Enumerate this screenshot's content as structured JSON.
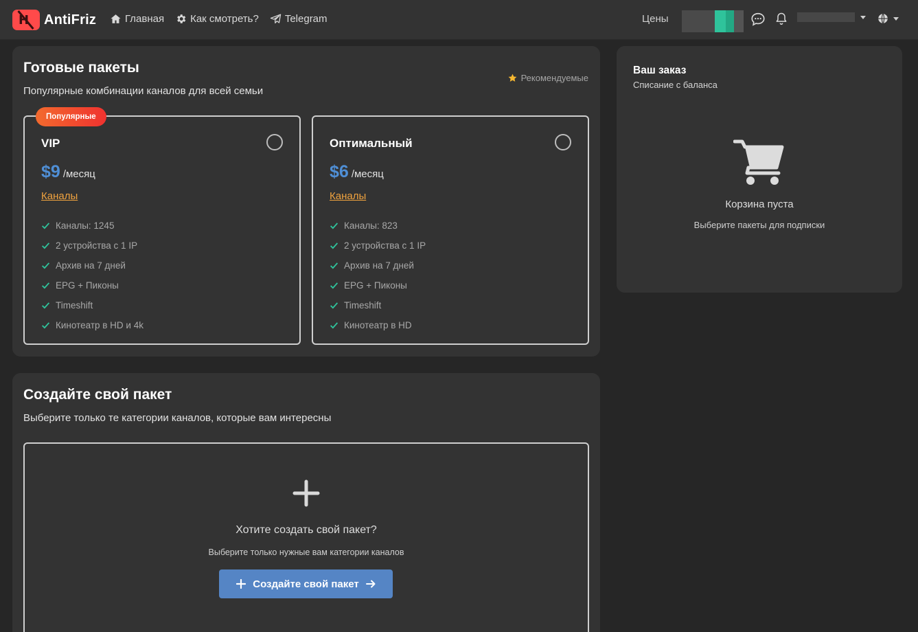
{
  "brand": {
    "name": "AntiFriz",
    "logo_letter": "H",
    "accent": "#ff4a4a"
  },
  "nav": [
    {
      "label": "Главная",
      "icon": "home-icon"
    },
    {
      "label": "Как смотреть?",
      "icon": "gear-icon"
    },
    {
      "label": "Telegram",
      "icon": "telegram-icon"
    }
  ],
  "header_right": {
    "prices_label": "Цены"
  },
  "packages": {
    "title": "Готовые пакеты",
    "subtitle": "Популярные комбинации каналов для всей семьи",
    "recommended_label": "Рекомендуемые",
    "items": [
      {
        "badge": "Популярные",
        "name": "VIP",
        "price": "$9",
        "period": "/месяц",
        "channels_link": "Каналы",
        "features": [
          "Каналы: 1245",
          "2 устройства с 1 IP",
          "Архив на 7 дней",
          "EPG + Пиконы",
          "Timeshift",
          "Кинотеатр в HD и 4k"
        ]
      },
      {
        "name": "Оптимальный",
        "price": "$6",
        "period": "/месяц",
        "channels_link": "Каналы",
        "features": [
          "Каналы: 823",
          "2 устройства с 1 IP",
          "Архив на 7 дней",
          "EPG + Пиконы",
          "Timeshift",
          "Кинотеатр в HD"
        ]
      }
    ]
  },
  "order": {
    "title": "Ваш заказ",
    "subtitle": "Списание с баланса",
    "empty_title": "Корзина пуста",
    "empty_hint": "Выберите пакеты для подписки"
  },
  "custom": {
    "title": "Создайте свой пакет",
    "subtitle": "Выберите только те категории каналов, которые вам интересны",
    "question": "Хотите создать свой пакет?",
    "hint": "Выберите только нужные вам категории каналов",
    "button_label": "Создайте свой пакет"
  },
  "colors": {
    "price": "#4f8fd6",
    "link": "#f0a33f",
    "check": "#2fc39b",
    "button": "#5585c5",
    "badge": "#f0322f",
    "star": "#f5b731"
  }
}
